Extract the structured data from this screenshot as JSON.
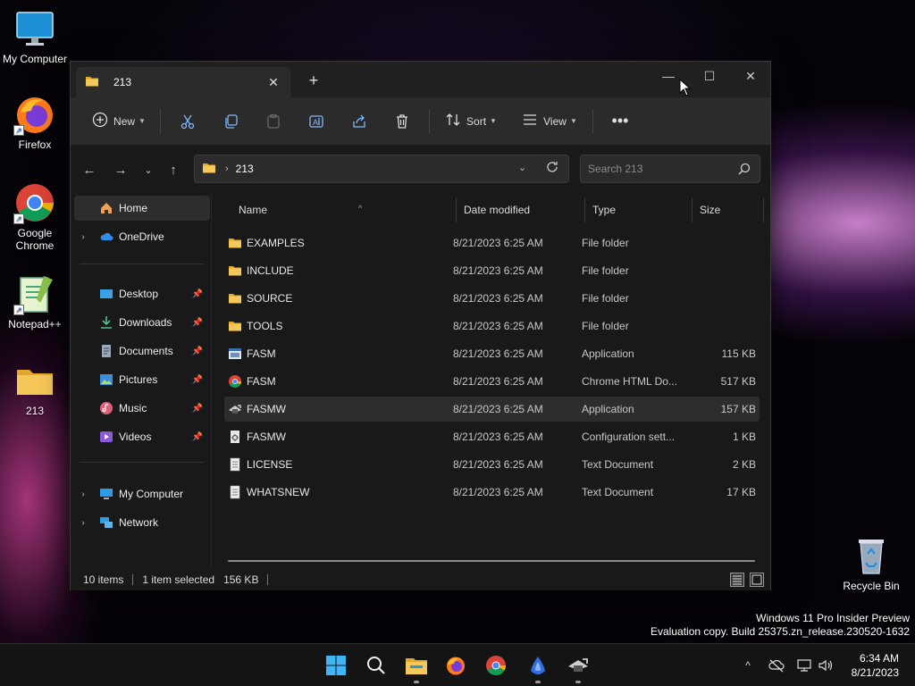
{
  "desktop": {
    "icons": [
      {
        "label": "My Computer"
      },
      {
        "label": "Firefox"
      },
      {
        "label": "Google Chrome"
      },
      {
        "label": "Notepad++"
      },
      {
        "label": "213"
      },
      {
        "label": "Recycle Bin"
      }
    ]
  },
  "window": {
    "tab_title": "213",
    "toolbar": {
      "new_label": "New",
      "sort_label": "Sort",
      "view_label": "View"
    },
    "address": {
      "crumb": "213"
    },
    "search": {
      "placeholder": "Search 213"
    },
    "nav": {
      "home": "Home",
      "onedrive": "OneDrive",
      "desktop": "Desktop",
      "downloads": "Downloads",
      "documents": "Documents",
      "pictures": "Pictures",
      "music": "Music",
      "videos": "Videos",
      "mycomputer": "My Computer",
      "network": "Network"
    },
    "columns": {
      "name": "Name",
      "date": "Date modified",
      "type": "Type",
      "size": "Size"
    },
    "files": [
      {
        "name": "EXAMPLES",
        "date": "8/21/2023 6:25 AM",
        "type": "File folder",
        "size": ""
      },
      {
        "name": "INCLUDE",
        "date": "8/21/2023 6:25 AM",
        "type": "File folder",
        "size": ""
      },
      {
        "name": "SOURCE",
        "date": "8/21/2023 6:25 AM",
        "type": "File folder",
        "size": ""
      },
      {
        "name": "TOOLS",
        "date": "8/21/2023 6:25 AM",
        "type": "File folder",
        "size": ""
      },
      {
        "name": "FASM",
        "date": "8/21/2023 6:25 AM",
        "type": "Application",
        "size": "115 KB"
      },
      {
        "name": "FASM",
        "date": "8/21/2023 6:25 AM",
        "type": "Chrome HTML Do...",
        "size": "517 KB"
      },
      {
        "name": "FASMW",
        "date": "8/21/2023 6:25 AM",
        "type": "Application",
        "size": "157 KB"
      },
      {
        "name": "FASMW",
        "date": "8/21/2023 6:25 AM",
        "type": "Configuration sett...",
        "size": "1 KB"
      },
      {
        "name": "LICENSE",
        "date": "8/21/2023 6:25 AM",
        "type": "Text Document",
        "size": "2 KB"
      },
      {
        "name": "WHATSNEW",
        "date": "8/21/2023 6:25 AM",
        "type": "Text Document",
        "size": "17 KB"
      }
    ],
    "status": {
      "count": "10 items",
      "selected": "1 item selected",
      "size": "156 KB"
    }
  },
  "watermark": {
    "line1": "Windows 11 Pro Insider Preview",
    "line2": "Evaluation copy. Build 25375.zn_release.230520-1632"
  },
  "taskbar": {
    "time": "6:34 AM",
    "date": "8/21/2023"
  },
  "colors": {
    "accent": "#4cc2ff",
    "folder": "#f2c14e",
    "window_bg": "#191919",
    "toolbar_bg": "#2b2b2b"
  }
}
